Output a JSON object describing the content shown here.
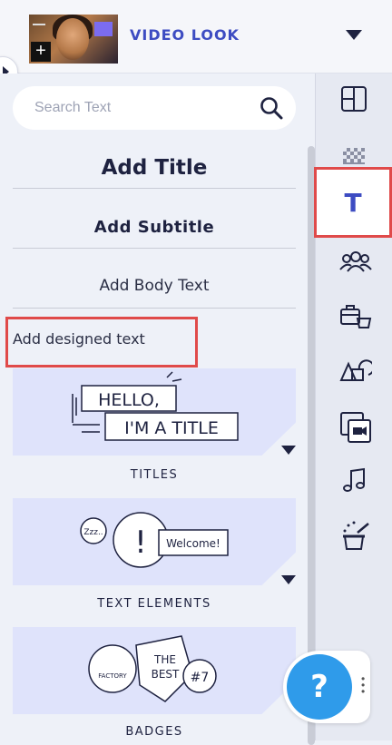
{
  "header": {
    "title": "VIDEO LOOK",
    "thumbnail_icon": "video-thumbnail",
    "dropdown_icon": "caret-down-icon"
  },
  "search": {
    "placeholder": "Search Text"
  },
  "text_options": {
    "title": "Add Title",
    "subtitle": "Add Subtitle",
    "body": "Add Body Text",
    "designed": "Add designed text"
  },
  "cards": [
    {
      "label": "TITLES",
      "art_line1": "HELLO,",
      "art_line2": "I'M A TITLE"
    },
    {
      "label": "TEXT ELEMENTS",
      "art_bubble1": "Zzz..",
      "art_bubble2": "!",
      "art_bubble3": "Welcome!"
    },
    {
      "label": "BADGES",
      "art_badge1": "FACTORY",
      "art_badge2_line1": "THE",
      "art_badge2_line2": "BEST",
      "art_badge3": "#7"
    }
  ],
  "rail": {
    "items": [
      "layout-icon",
      "background-icon",
      "text-icon",
      "characters-icon",
      "props-icon",
      "shapes-icon",
      "media-icon",
      "music-icon",
      "effects-icon"
    ],
    "active_label": "T"
  },
  "help": {
    "label": "?"
  },
  "colors": {
    "accent": "#3d4cc2",
    "highlight": "#e04a4a",
    "card": "#dfe3fb",
    "help": "#2f9bea"
  }
}
